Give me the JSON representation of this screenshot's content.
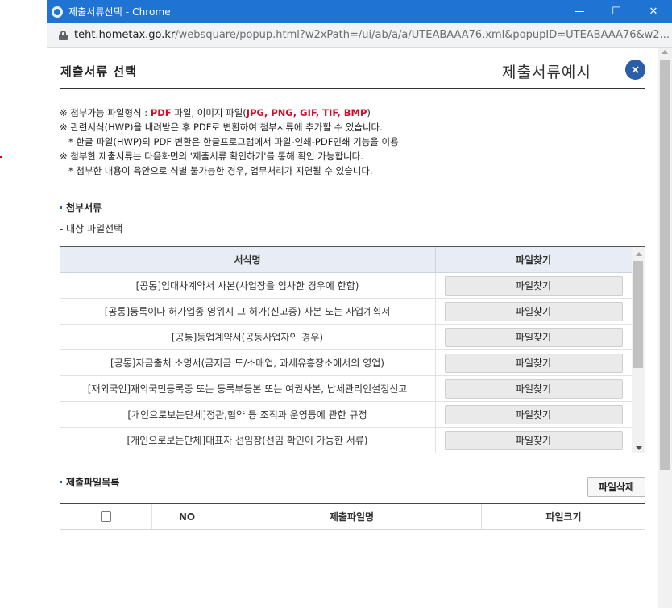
{
  "window": {
    "title": "제출서류선택 - Chrome",
    "url_host": "teht.hometax.go.kr",
    "url_rest": "/websquare/popup.html?w2xPath=/ui/ab/a/a/UTEABAAA76.xml&popupID=UTEABAAA76&w2..."
  },
  "header": {
    "title": "제출서류 선택",
    "example_link": "제출서류예시",
    "close_glyph": "×"
  },
  "notes": {
    "line1_prefix": "※ 첨부가능 파일형식 : ",
    "line1_pdf": "PDF",
    "line1_mid": " 파일, 이미지 파일(",
    "line1_formats": "JPG, PNG, GIF, TIF, BMP",
    "line1_suffix": ")",
    "line2": "※ 관련서식(HWP)을 내려받은 후 PDF로 변환하여 첨부서류에 추가할 수 있습니다.",
    "line3": "* 한글 파일(HWP)의 PDF 변환은 한글프로그램에서 파일-인쇄-PDF인쇄 기능을 이용",
    "line4": "※ 첨부한 제출서류는 다음화면의 '제출서류 확인하기'를 통해 확인 가능합니다.",
    "line5": "* 첨부한 내용이 육안으로 식별 불가능한 경우, 업무처리가 지연될 수 있습니다."
  },
  "attach_section": {
    "label": "첨부서류",
    "subnote": "- 대상 파일선택",
    "col_form_name": "서식명",
    "col_find_file": "파일찾기",
    "rows": [
      {
        "name": "[공통]임대차계약서 사본(사업장을 임차한 경우에 한함)",
        "button": "파일찾기"
      },
      {
        "name": "[공통]등록이나 허가업종 영위시 그 허가(신고증) 사본 또는 사업계획서",
        "button": "파일찾기"
      },
      {
        "name": "[공통]동업계약서(공동사업자인 경우)",
        "button": "파일찾기"
      },
      {
        "name": "[공통]자금출처 소명서(금지금 도/소매업, 과세유흥장소에서의 영업)",
        "button": "파일찾기"
      },
      {
        "name": "[재외국인]재외국민등록증 또는 등록부등본 또는 여권사본, 납세관리인설정신고",
        "button": "파일찾기"
      },
      {
        "name": "[개인으로보는단체]정관,협약 등 조직과 운영등에 관한 규정",
        "button": "파일찾기"
      },
      {
        "name": "[개인으로보는단체]대표자 선임장(선임 확인이 가능한 서류)",
        "button": "파일찾기"
      }
    ]
  },
  "submit_section": {
    "label": "제출파일목록",
    "delete_button": "파일삭제",
    "col_no": "NO",
    "col_file_name": "제출파일명",
    "col_file_size": "파일크기"
  }
}
